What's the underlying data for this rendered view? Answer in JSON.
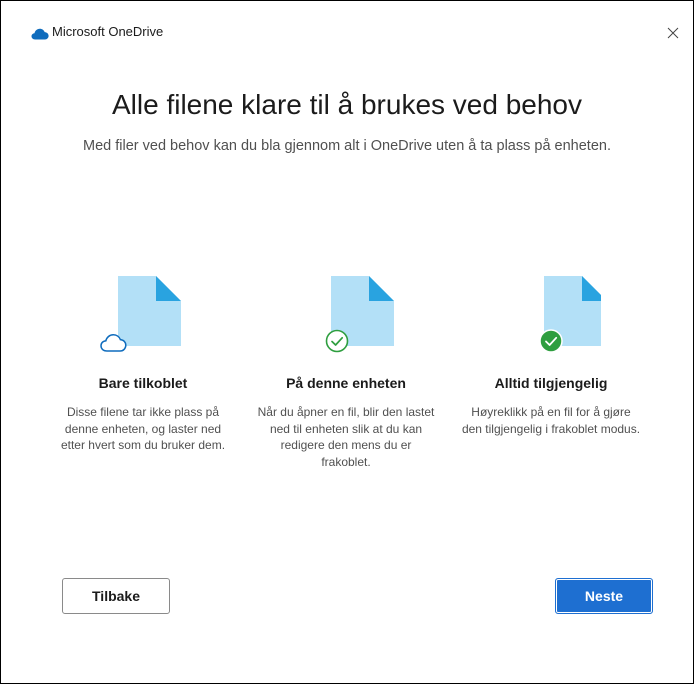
{
  "window": {
    "title": "Microsoft OneDrive",
    "logo_icon": "onedrive-cloud-icon",
    "close_icon": "close-icon"
  },
  "main": {
    "heading": "Alle filene klare til å brukes ved behov",
    "subheading": "Med filer ved behov kan du bla gjennom alt i OneDrive uten å ta plass på enheten."
  },
  "columns": [
    {
      "title": "Bare tilkoblet",
      "text": "Disse filene tar ikke plass på denne enheten, og laster ned etter hvert som du bruker dem.",
      "icon": "online-only-cloud-icon"
    },
    {
      "title": "På denne enheten",
      "text": "Når du åpner en fil, blir den lastet ned til enheten slik at du kan redigere den mens du er frakoblet.",
      "icon": "locally-available-check-icon"
    },
    {
      "title": "Alltid tilgjengelig",
      "text": "Høyreklikk på en fil for å gjøre den tilgjengelig i frakoblet modus.",
      "icon": "always-available-check-icon"
    }
  ],
  "buttons": {
    "back_label": "Tilbake",
    "next_label": "Neste"
  },
  "colors": {
    "accent": "#1e6fd1",
    "file_light": "#b3e0f7",
    "file_fold": "#29a3e0",
    "cloud_stroke": "#0f6cbd",
    "check_green": "#2e9e3f"
  }
}
